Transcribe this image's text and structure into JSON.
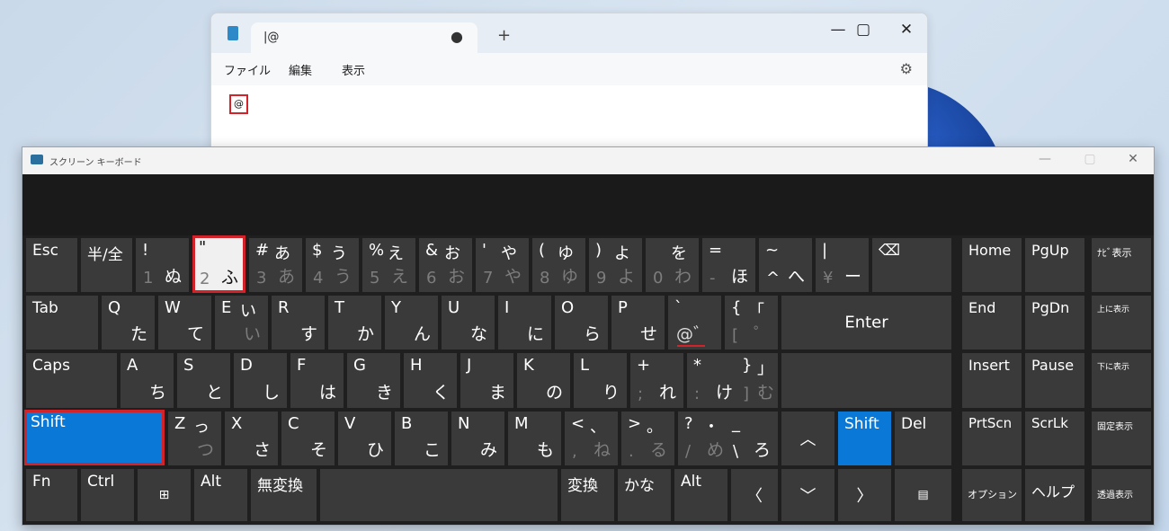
{
  "notepad": {
    "tab_title": "|@",
    "tab_dot": "●",
    "new_tab": "+",
    "minimize": "—",
    "maximize": "▢",
    "close": "✕",
    "menus": [
      "ファイル",
      "編集",
      "表示"
    ],
    "settings_icon": "gear-icon",
    "settings_glyph": "⚙",
    "content": "@"
  },
  "osk": {
    "title": "スクリーン キーボード",
    "minimize": "—",
    "maximize": "▢",
    "close": "✕",
    "keys": {
      "esc": "Esc",
      "hankaku": "半/全",
      "k1": {
        "top": "!",
        "bl": "1",
        "br": "ぬ"
      },
      "k2": {
        "top": "\"",
        "bl": "2",
        "br": "ふ"
      },
      "k3": {
        "top": "#",
        "tr": "あ",
        "bl": "3",
        "br": "あ"
      },
      "k4": {
        "top": "$",
        "tr": "う",
        "bl": "4",
        "br": "う"
      },
      "k5": {
        "top": "%",
        "tr": "え",
        "bl": "5",
        "br": "え"
      },
      "k6": {
        "top": "&",
        "tr": "お",
        "bl": "6",
        "br": "お"
      },
      "k7": {
        "top": "'",
        "tr": "や",
        "bl": "7",
        "br": "や"
      },
      "k8": {
        "top": "(",
        "tr": "ゆ",
        "bl": "8",
        "br": "ゆ"
      },
      "k9": {
        "top": ")",
        "tr": "よ",
        "bl": "9",
        "br": "よ"
      },
      "k0": {
        "tr": "を",
        "bl": "0",
        "br": "わ"
      },
      "kminus": {
        "top": "=",
        "bl": "-",
        "br": "ほ"
      },
      "kcaret": {
        "top": "~",
        "bl": "^",
        "br": "へ"
      },
      "kyen": {
        "top": "|",
        "bl": "¥",
        "br": "ー"
      },
      "backspace": "⌫",
      "tab": "Tab",
      "q": {
        "top": "Q",
        "br": "た"
      },
      "w": {
        "top": "W",
        "br": "て"
      },
      "e": {
        "top": "E",
        "tr": "い",
        "br": "い"
      },
      "r": {
        "top": "R",
        "br": "す"
      },
      "t": {
        "top": "T",
        "br": "か"
      },
      "y": {
        "top": "Y",
        "br": "ん"
      },
      "u": {
        "top": "U",
        "br": "な"
      },
      "i": {
        "top": "I",
        "br": "に"
      },
      "o": {
        "top": "O",
        "br": "ら"
      },
      "p": {
        "top": "P",
        "br": "せ"
      },
      "at": {
        "top": "`",
        "br": "@゛"
      },
      "lbracket": {
        "top": "{",
        "tr": "「",
        "bl": "[",
        "br": "゜"
      },
      "enter": "Enter",
      "caps": "Caps",
      "a": {
        "top": "A",
        "br": "ち"
      },
      "s": {
        "top": "S",
        "br": "と"
      },
      "d": {
        "top": "D",
        "br": "し"
      },
      "f": {
        "top": "F",
        "br": "は"
      },
      "g": {
        "top": "G",
        "br": "き"
      },
      "h": {
        "top": "H",
        "br": "く"
      },
      "j": {
        "top": "J",
        "br": "ま"
      },
      "k": {
        "top": "K",
        "br": "の"
      },
      "l": {
        "top": "L",
        "br": "り"
      },
      "semicolon": {
        "top": "+",
        "bl": ";",
        "br": "れ"
      },
      "colon": {
        "top": "*",
        "bl": ":",
        "br": "け"
      },
      "rbracket": {
        "top": "}",
        "tr": "」",
        "bl": "]",
        "br": "む"
      },
      "shift_l": "Shift",
      "z": {
        "top": "Z",
        "tr": "っ",
        "br": "つ"
      },
      "x": {
        "top": "X",
        "br": "さ"
      },
      "c": {
        "top": "C",
        "br": "そ"
      },
      "v": {
        "top": "V",
        "br": "ひ"
      },
      "b": {
        "top": "B",
        "br": "こ"
      },
      "n": {
        "top": "N",
        "br": "み"
      },
      "m": {
        "top": "M",
        "br": "も"
      },
      "comma": {
        "top": "<",
        "tr": "、",
        "bl": ",",
        "br": "ね"
      },
      "period": {
        "top": ">",
        "tr": "。",
        "bl": ".",
        "br": "る"
      },
      "slash": {
        "top": "?",
        "tr": "・",
        "bl": "/",
        "br": "め"
      },
      "backslash": {
        "top": "_",
        "bl": "\\",
        "br": "ろ"
      },
      "up": "︿",
      "shift_r": "Shift",
      "del": "Del",
      "fn": "Fn",
      "ctrl": "Ctrl",
      "win": "⊞",
      "alt_l": "Alt",
      "muhenkan": "無変換",
      "henkan": "変換",
      "kana": "かな",
      "alt_r": "Alt",
      "left": "〈",
      "down": "﹀",
      "right": "〉",
      "menu": "▤",
      "home": "Home",
      "pgup": "PgUp",
      "navi": "ﾅﾋﾞ表示",
      "end": "End",
      "pgdn": "PgDn",
      "upper": "上に表示",
      "insert": "Insert",
      "pause": "Pause",
      "lower": "下に表示",
      "prtscn": "PrtScn",
      "scrlk": "ScrLk",
      "fixed": "固定表示",
      "option": "オプション",
      "help": "ヘルプ",
      "transparent": "透過表示"
    }
  }
}
